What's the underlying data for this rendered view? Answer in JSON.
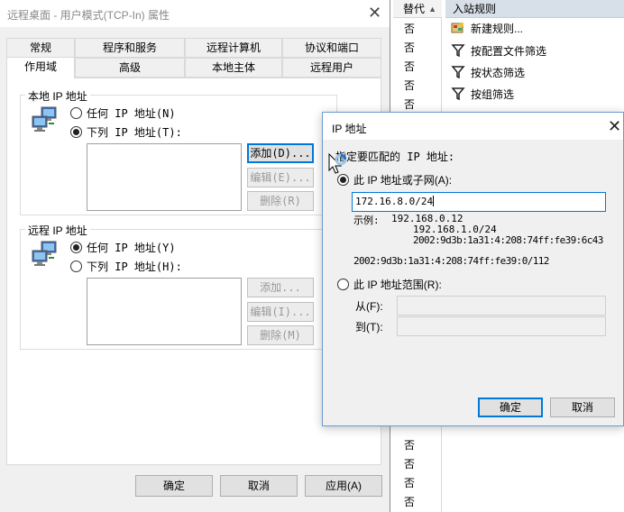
{
  "background_list": {
    "header": "替代",
    "header_sort_arrow": "▲",
    "top_values": [
      "否",
      "否",
      "否",
      "否",
      "否"
    ],
    "bottom_values": [
      "否",
      "否",
      "否",
      "否"
    ]
  },
  "actions_pane": {
    "header": "入站规则",
    "items": [
      {
        "label": "新建规则...",
        "icon": "new-rule-icon"
      },
      {
        "label": "按配置文件筛选",
        "icon": "filter-icon"
      },
      {
        "label": "按状态筛选",
        "icon": "filter-icon"
      },
      {
        "label": "按组筛选",
        "icon": "filter-icon"
      }
    ]
  },
  "properties_dialog": {
    "title": "远程桌面 - 用户模式(TCP-In) 属性",
    "close_glyph": "✕",
    "tabs_row1": [
      "常规",
      "程序和服务",
      "远程计算机",
      "协议和端口"
    ],
    "tabs_row2": [
      "作用域",
      "高级",
      "本地主体",
      "远程用户"
    ],
    "active_tab": "作用域",
    "local_group": {
      "label": "本地 IP 地址",
      "option_any": "任何 IP 地址(N)",
      "option_list": "下列 IP 地址(T):",
      "selected": "list",
      "buttons": {
        "add": "添加(D)...",
        "edit": "编辑(E)...",
        "remove": "删除(R)"
      }
    },
    "remote_group": {
      "label": "远程 IP 地址",
      "option_any": "任何 IP 地址(Y)",
      "option_list": "下列 IP 地址(H):",
      "selected": "any",
      "buttons": {
        "add": "添加...",
        "edit": "编辑(I)...",
        "remove": "删除(M)"
      }
    },
    "footer": {
      "ok": "确定",
      "cancel": "取消",
      "apply": "应用(A)"
    }
  },
  "ip_dialog": {
    "title": "IP 地址",
    "close_glyph": "✕",
    "prompt": "指定要匹配的 IP 地址:",
    "option_subnet": "此 IP 地址或子网(A):",
    "subnet_value": "172.16.8.0/24",
    "examples_label": "示例:",
    "examples": [
      "192.168.0.12",
      "192.168.1.0/24",
      "2002:9d3b:1a31:4:208:74ff:fe39:6c43",
      "2002:9d3b:1a31:4:208:74ff:fe39:0/112"
    ],
    "option_range": "此 IP 地址范围(R):",
    "from_label": "从(F):",
    "to_label": "到(T):",
    "selected": "subnet",
    "ok": "确定",
    "cancel": "取消"
  },
  "colors": {
    "accent": "#0078d7",
    "actions_header": "#d7dfe8"
  }
}
